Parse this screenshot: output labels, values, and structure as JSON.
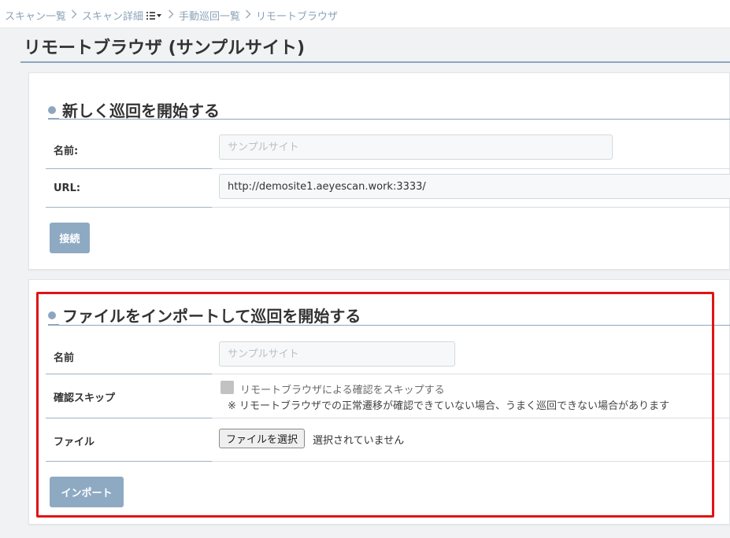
{
  "breadcrumb": {
    "items": [
      "スキャン一覧",
      "スキャン詳細",
      "手動巡回一覧",
      "リモートブラウザ"
    ],
    "separator": ">"
  },
  "page": {
    "title": "リモートブラウザ (サンプルサイト)"
  },
  "connect_section": {
    "heading": "新しく巡回を開始する",
    "name_label": "名前:",
    "name_placeholder": "サンプルサイト",
    "url_label": "URL:",
    "url_value": "http://demosite1.aeyescan.work:3333/",
    "connect_button": "接続"
  },
  "import_section": {
    "heading": "ファイルをインポートして巡回を開始する",
    "name_label": "名前",
    "name_placeholder": "サンプルサイト",
    "skip_label": "確認スキップ",
    "skip_checkbox_label": "リモートブラウザによる確認をスキップする",
    "skip_note": "※ リモートブラウザでの正常遷移が確認できていない場合、うまく巡回できない場合があります",
    "skip_checked": false,
    "file_label": "ファイル",
    "file_button": "ファイルを選択",
    "file_status": "選択されていません",
    "import_button": "インポート"
  },
  "colors": {
    "accent": "#8eaac3",
    "highlight": "#e01414",
    "breadcrumb": "#8aa2b8"
  },
  "icons": {
    "breadcrumb_separator": "chevron-right-icon",
    "scan_detail_menu": "list-menu-icon",
    "section_bullet": "dot-icon"
  }
}
